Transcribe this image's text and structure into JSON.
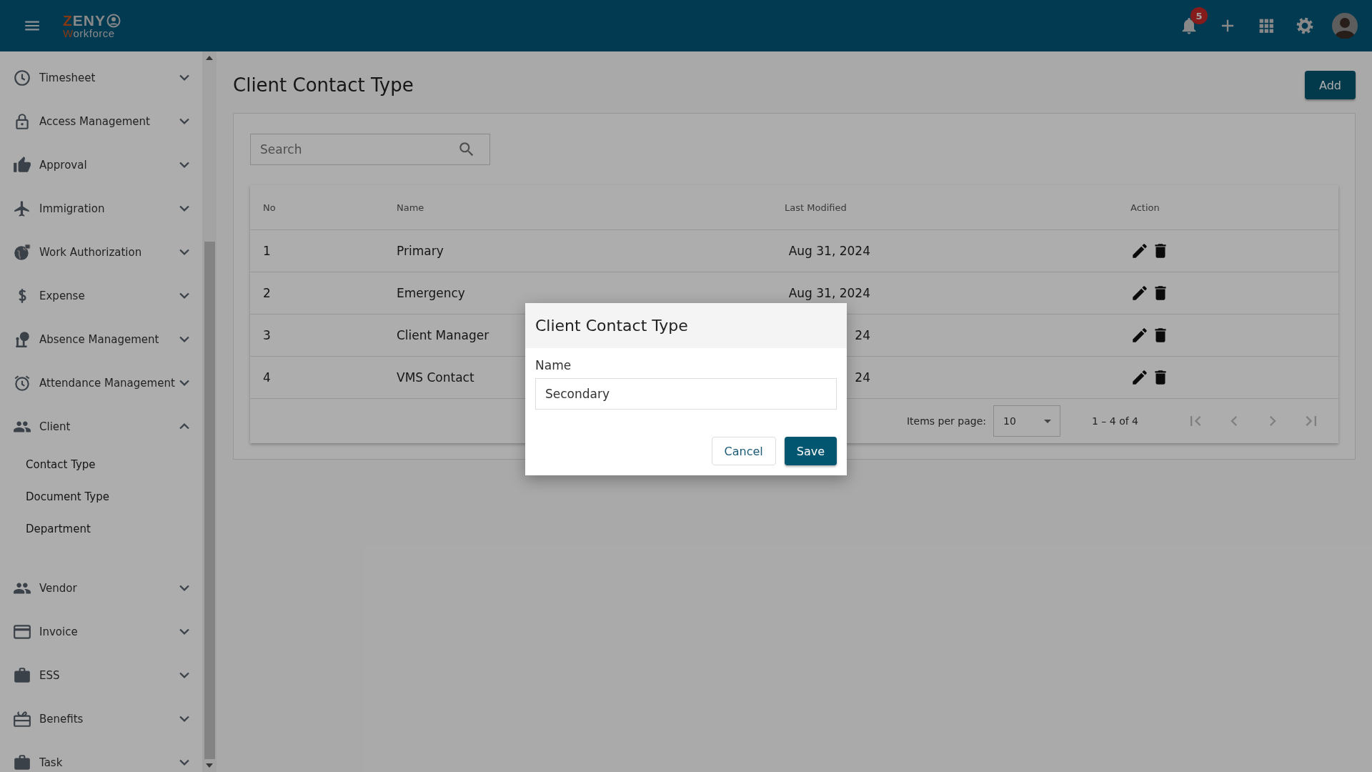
{
  "topbar": {
    "logo_initial": "Z",
    "logo_rest": "ENY",
    "logo_sub_initial": "W",
    "logo_sub_rest": "orkforce",
    "notification_count": "5"
  },
  "sidebar": {
    "items": [
      {
        "label": "Timesheet",
        "expanded": false
      },
      {
        "label": "Access Management",
        "expanded": false
      },
      {
        "label": "Approval",
        "expanded": false
      },
      {
        "label": "Immigration",
        "expanded": false
      },
      {
        "label": "Work Authorization",
        "expanded": false
      },
      {
        "label": "Expense",
        "expanded": false
      },
      {
        "label": "Absence Management",
        "expanded": false
      },
      {
        "label": "Attendance Management",
        "expanded": false
      },
      {
        "label": "Client",
        "expanded": true,
        "children": [
          {
            "label": "Contact Type"
          },
          {
            "label": "Document Type"
          },
          {
            "label": "Department"
          }
        ]
      },
      {
        "label": "Vendor",
        "expanded": false
      },
      {
        "label": "Invoice",
        "expanded": false
      },
      {
        "label": "ESS",
        "expanded": false
      },
      {
        "label": "Benefits",
        "expanded": false
      },
      {
        "label": "Task",
        "expanded": false
      }
    ]
  },
  "page": {
    "title": "Client Contact Type",
    "add_button": "Add",
    "search": {
      "placeholder": "Search"
    }
  },
  "table": {
    "columns": [
      "No",
      "Name",
      "Last Modified",
      "Action"
    ],
    "rows": [
      {
        "no": "1",
        "name": "Primary",
        "last_modified": "Aug 31, 2024"
      },
      {
        "no": "2",
        "name": "Emergency",
        "last_modified": "Aug 31, 2024"
      },
      {
        "no": "3",
        "name": "Client Manager",
        "last_modified": "24"
      },
      {
        "no": "4",
        "name": "VMS Contact",
        "last_modified": "24"
      }
    ]
  },
  "pagination": {
    "items_per_page_label": "Items per page:",
    "page_size": "10",
    "range": "1 – 4 of 4",
    "buttons": [
      {
        "kind": "first",
        "disabled": true
      },
      {
        "kind": "prev",
        "disabled": true
      },
      {
        "kind": "next",
        "disabled": true
      },
      {
        "kind": "last",
        "disabled": true
      }
    ]
  },
  "dialog": {
    "title": "Client Contact Type",
    "field_label": "Name",
    "field_value": "Secondary",
    "buttons": [
      {
        "label": "Cancel",
        "kind": "secondary"
      },
      {
        "label": "Save",
        "kind": "primary"
      }
    ]
  }
}
